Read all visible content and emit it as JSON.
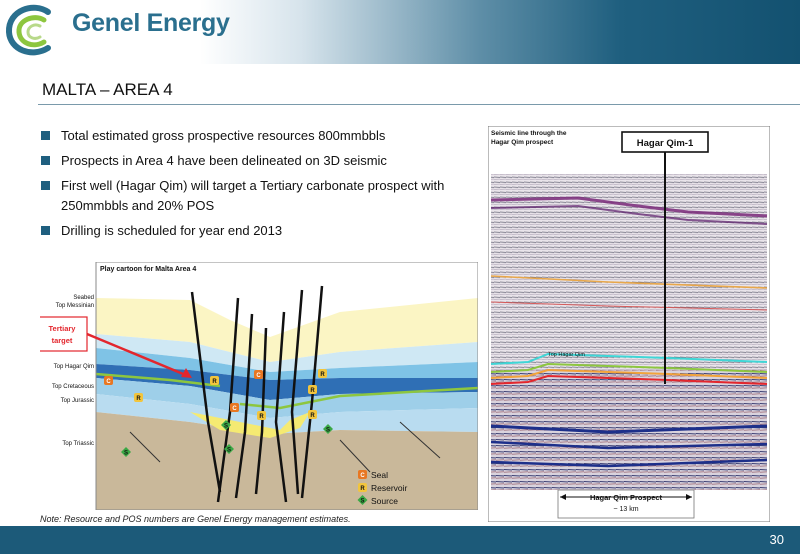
{
  "header": {
    "brand": "Genel Energy"
  },
  "slide": {
    "title": "MALTA – AREA 4",
    "bullets": [
      "Total estimated gross prospective resources 800mmbbls",
      "Prospects in Area 4 have been delineated on 3D seismic",
      "First well (Hagar Qim) will target a Tertiary carbonate prospect with 250mmbbls and 20% POS",
      "Drilling is scheduled for year end 2013"
    ],
    "note": "Note: Resource and POS numbers are Genel Energy management estimates.",
    "page_number": "30"
  },
  "cartoon": {
    "caption": "Play cartoon for Malta Area 4",
    "labels": {
      "seabed": "Seabed",
      "top_messinian": "Top Messinian",
      "tertiary_target_1": "Tertiary",
      "tertiary_target_2": "target",
      "top_hagar_qim": "Top Hagar Qim",
      "top_cretaceous": "Top Cretaceous",
      "top_jurassic": "Top Jurassic",
      "top_triassic": "Top Triassic"
    },
    "legend": {
      "seal": {
        "letter": "C",
        "label": "Seal",
        "color": "#e87722"
      },
      "reservoir": {
        "letter": "R",
        "label": "Reservoir",
        "color": "#f2c53d"
      },
      "source": {
        "letter": "S",
        "label": "Source",
        "color": "#3aa845"
      }
    }
  },
  "seismic": {
    "caption_1": "Seismic line through the",
    "caption_2": "Hagar Qim prospect",
    "well": "Hagar Qim-1",
    "horizon_label": "Top Hagar Qim",
    "prospect_label": "Hagar Qim Prospect",
    "distance_label": "~ 13 km"
  },
  "colors": {
    "brand": "#1f5f7f",
    "accent_red": "#e3262d"
  }
}
